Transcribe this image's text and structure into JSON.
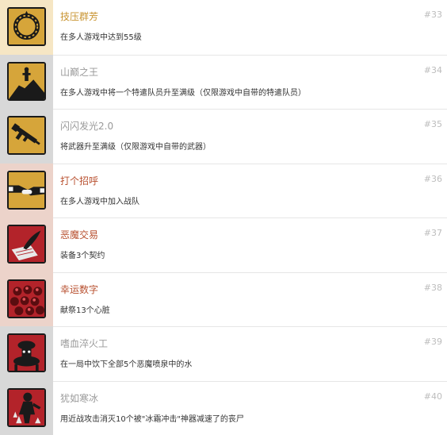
{
  "colors": {
    "gold_accent": "#c8932f",
    "red_accent": "#b8502f",
    "grey_title": "#9a9a9a",
    "badge_gold": "#d6a53a",
    "badge_red": "#b3232a"
  },
  "achievements": [
    {
      "title": "技压群芳",
      "number": "#33",
      "description": "在多人游戏中达到55级",
      "tier": "gold",
      "icon": "laurel-wreath-icon"
    },
    {
      "title": "山巅之王",
      "number": "#34",
      "description": "在多人游戏中将一个特遣队员升至满级（仅限游戏中自带的特遣队员）",
      "tier": "grey",
      "icon": "soldier-on-peak-icon"
    },
    {
      "title": "闪闪发光2.0",
      "number": "#35",
      "description": "将武器升至满级（仅限游戏中自带的武器）",
      "tier": "grey",
      "icon": "rifle-icon"
    },
    {
      "title": "打个招呼",
      "number": "#36",
      "description": "在多人游戏中加入战队",
      "tier": "red",
      "icon": "handshake-icon"
    },
    {
      "title": "恶魔交易",
      "number": "#37",
      "description": "装备3个契约",
      "tier": "red",
      "icon": "quill-contract-icon"
    },
    {
      "title": "幸运数字",
      "number": "#38",
      "description": "献祭13个心脏",
      "tier": "red",
      "icon": "hearts-pile-icon"
    },
    {
      "title": "嗜血淬火工",
      "number": "#39",
      "description": "在一局中饮下全部5个恶魔喷泉中的水",
      "tier": "grey",
      "icon": "demon-fountain-icon"
    },
    {
      "title": "犹如寒冰",
      "number": "#40",
      "description": "用近战攻击消灭10个被\"冰霜冲击\"神器减速了的丧尸",
      "tier": "grey",
      "icon": "frozen-zombie-icon"
    }
  ]
}
